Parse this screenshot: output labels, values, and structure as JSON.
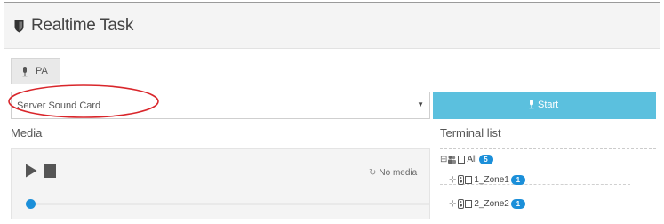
{
  "header": {
    "title": "Realtime Task",
    "title_icon": "shield-icon"
  },
  "tabs": [
    {
      "label": "PA",
      "icon": "microphone-icon"
    }
  ],
  "source_select": {
    "value": "Server Sound Card",
    "caret_icon": "caret-down-icon"
  },
  "start_button": {
    "label": "Start",
    "icon": "microphone-icon",
    "color": "#5bc0de"
  },
  "media": {
    "label": "Media",
    "status": "No media",
    "status_icon": "loading-icon",
    "progress": 0
  },
  "terminal_list": {
    "label": "Terminal list",
    "items": [
      {
        "name": "All",
        "count": "5",
        "icons": [
          "tree-toggle-icon",
          "group-icon"
        ]
      },
      {
        "name": "1_Zone1",
        "count": "1",
        "icons": [
          "branch-icon",
          "speaker-icon"
        ]
      },
      {
        "name": "2_Zone2",
        "count": "1",
        "icons": [
          "branch-icon",
          "speaker-icon"
        ]
      }
    ]
  },
  "colors": {
    "accent": "#1b8fd9",
    "start_button": "#5bc0de",
    "annotation_ellipse": "#d9262b",
    "header_bg": "#f4f4f4"
  }
}
